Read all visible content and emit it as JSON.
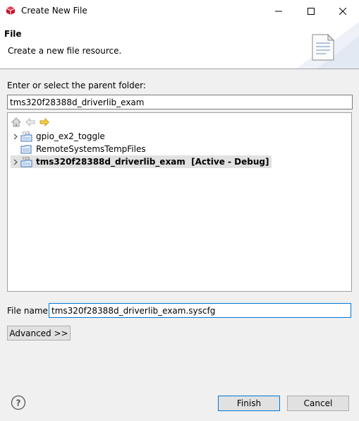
{
  "window": {
    "title": "Create New File",
    "app_icon": "red-cube-icon",
    "controls": [
      "minimize-icon",
      "maximize-icon",
      "close-icon"
    ]
  },
  "header": {
    "title": "File",
    "description": "Create a new file resource.",
    "icon": "document-icon"
  },
  "parent_folder": {
    "label": "Enter or select the parent folder:",
    "value": "tms320f28388d_driverlib_exam"
  },
  "tree": {
    "toolbar": [
      "home-icon",
      "back-arrow-icon",
      "forward-arrow-icon"
    ],
    "items": [
      {
        "label": "gpio_ex2_toggle",
        "expandable": true,
        "icon": "ccs-project-icon",
        "selected": false
      },
      {
        "label": "RemoteSystemsTempFiles",
        "expandable": false,
        "icon": "folder-project-icon",
        "selected": false
      },
      {
        "label": "tms320f28388d_driverlib_exam  [Active - Debug]",
        "expandable": true,
        "icon": "ccs-project-icon",
        "selected": true
      }
    ]
  },
  "file_name": {
    "label": "File name:",
    "value": "tms320f28388d_driverlib_exam.syscfg"
  },
  "buttons": {
    "advanced": "Advanced >>",
    "finish": "Finish",
    "cancel": "Cancel",
    "help_icon": "help-icon"
  }
}
